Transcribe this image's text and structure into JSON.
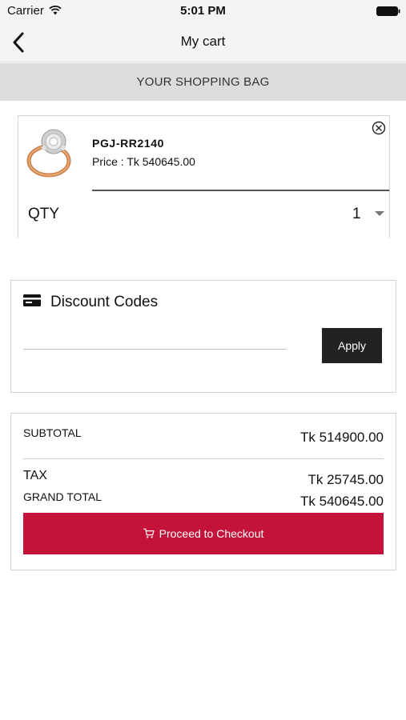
{
  "status_bar": {
    "carrier": "Carrier",
    "time": "5:01 PM",
    "icons": [
      "wifi-icon",
      "battery-icon"
    ]
  },
  "nav": {
    "title": "My cart",
    "back_icon": "chevron-left-icon"
  },
  "section_header": "YOUR SHOPPING BAG",
  "cart_items": [
    {
      "sku": "PGJ-RR2140",
      "price_label": "Price : Tk 540645.00",
      "thumbnail": "ring-image",
      "qty_label": "QTY",
      "qty": "1",
      "remove_icon": "close-circle-icon"
    }
  ],
  "discount": {
    "icon": "credit-card-icon",
    "title": "Discount Codes",
    "input_value": "",
    "apply_label": "Apply"
  },
  "totals": {
    "subtotal_label": "SUBTOTAL",
    "subtotal_value": "Tk 514900.00",
    "tax_label": "TAX",
    "tax_value": "Tk 25745.00",
    "grand_total_label": "GRAND TOTAL",
    "grand_total_value": "Tk 540645.00",
    "checkout_label": "Proceed to Checkout",
    "checkout_icon": "cart-icon"
  },
  "colors": {
    "checkout_bg": "#c4133a",
    "apply_bg": "#222222",
    "section_header_bg": "#dcdcdc",
    "nav_bg": "#f4f4f4"
  }
}
